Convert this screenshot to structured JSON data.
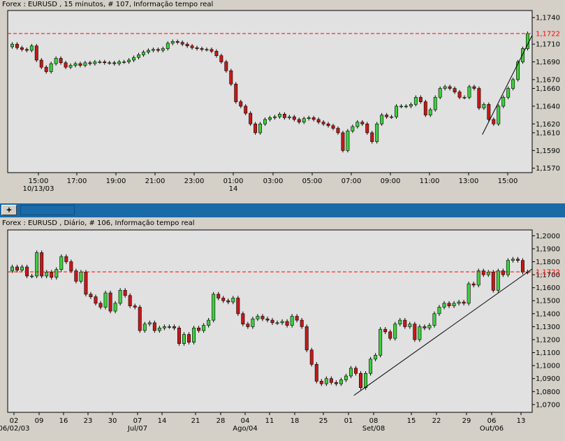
{
  "chart_data": [
    {
      "type": "candlestick",
      "title": "Forex : EURUSD , 15 minutos, # 107, Informação tempo real",
      "ylim": [
        1.1565,
        1.1748
      ],
      "y_ticks": [
        "1,1740",
        "1,1710",
        "1,1690",
        "1,1670",
        "1,1660",
        "1,1640",
        "1,1620",
        "1,1610",
        "1,1590",
        "1,1570"
      ],
      "y_tick_values": [
        1.174,
        1.171,
        1.169,
        1.167,
        1.166,
        1.164,
        1.162,
        1.161,
        1.159,
        1.157
      ],
      "x_ticks": [
        "15:00",
        "17:00",
        "19:00",
        "21:00",
        "23:00",
        "01:00",
        "03:00",
        "05:00",
        "07:00",
        "09:00",
        "11:00",
        "13:00",
        "15:00"
      ],
      "x_sub_labels": [
        "10/13/03",
        "",
        "",
        "",
        "",
        "14",
        "",
        "",
        "",
        "",
        "",
        "",
        ""
      ],
      "price_line": {
        "value": 1.1722,
        "label": "1,1722",
        "color": "#ff0000"
      },
      "trendline": {
        "from_bar": 0.905,
        "from_value": 1.1608,
        "to_bar": 1.0,
        "to_value": 1.172
      },
      "bar_count": 107,
      "closes": [
        1.171,
        1.1706,
        1.1704,
        1.1703,
        1.1708,
        1.1692,
        1.1684,
        1.1679,
        1.1688,
        1.1694,
        1.1689,
        1.1684,
        1.1686,
        1.1688,
        1.1686,
        1.1689,
        1.1688,
        1.169,
        1.169,
        1.1689,
        1.1689,
        1.1688,
        1.169,
        1.169,
        1.1692,
        1.1695,
        1.1698,
        1.1701,
        1.1703,
        1.1704,
        1.1703,
        1.1705,
        1.1711,
        1.1713,
        1.1712,
        1.171,
        1.1708,
        1.1706,
        1.1705,
        1.1704,
        1.1704,
        1.1702,
        1.1697,
        1.169,
        1.168,
        1.1665,
        1.1645,
        1.164,
        1.1632,
        1.162,
        1.161,
        1.162,
        1.1625,
        1.1627,
        1.1628,
        1.1631,
        1.1627,
        1.1628,
        1.1625,
        1.1622,
        1.1626,
        1.1627,
        1.1625,
        1.1622,
        1.162,
        1.1618,
        1.1615,
        1.161,
        1.159,
        1.1612,
        1.1617,
        1.1622,
        1.162,
        1.161,
        1.16,
        1.162,
        1.163,
        1.1628,
        1.1628,
        1.164,
        1.164,
        1.164,
        1.1642,
        1.165,
        1.1645,
        1.163,
        1.1636,
        1.165,
        1.166,
        1.1662,
        1.166,
        1.1656,
        1.165,
        1.165,
        1.1662,
        1.166,
        1.1638,
        1.1642,
        1.1625,
        1.162,
        1.164,
        1.165,
        1.166,
        1.167,
        1.169,
        1.1705,
        1.1722
      ]
    },
    {
      "type": "candlestick",
      "title": "Forex : EURUSD , Diário, # 106, Informação tempo real",
      "ylim": [
        1.064,
        1.2045
      ],
      "y_ticks": [
        "1,2000",
        "1,1900",
        "1,1800",
        "1,1700",
        "1,1600",
        "1,1500",
        "1,1400",
        "1,1300",
        "1,1200",
        "1,1100",
        "1,1000",
        "1,0900",
        "1,0800",
        "1,0700"
      ],
      "y_tick_values": [
        1.2,
        1.19,
        1.18,
        1.17,
        1.16,
        1.15,
        1.14,
        1.13,
        1.12,
        1.11,
        1.1,
        1.09,
        1.08,
        1.07
      ],
      "x_ticks": [
        "02",
        "09",
        "16",
        "23",
        "30",
        "07",
        "14",
        "21",
        "28",
        "04",
        "11",
        "18",
        "25",
        "01",
        "08",
        "15",
        "22",
        "29",
        "06",
        "13"
      ],
      "x_sub_labels": [
        "06/02/03",
        "",
        "",
        "",
        "",
        "Jul/07",
        "",
        "",
        "",
        "Ago/04",
        "",
        "",
        "",
        "",
        "Set/08",
        "",
        "",
        "",
        "Out/06",
        ""
      ],
      "price_line": {
        "value": 1.1722,
        "label": "1,1722",
        "color": "#ff0000"
      },
      "trendline": {
        "from_bar": 0.66,
        "from_value": 1.077,
        "to_bar": 1.0,
        "to_value": 1.1745
      },
      "bar_count": 106,
      "closes": [
        1.176,
        1.1735,
        1.176,
        1.169,
        1.169,
        1.187,
        1.169,
        1.172,
        1.168,
        1.174,
        1.184,
        1.18,
        1.173,
        1.165,
        1.172,
        1.155,
        1.153,
        1.148,
        1.145,
        1.156,
        1.142,
        1.148,
        1.158,
        1.154,
        1.146,
        1.145,
        1.127,
        1.132,
        1.133,
        1.127,
        1.129,
        1.13,
        1.13,
        1.129,
        1.117,
        1.124,
        1.118,
        1.129,
        1.127,
        1.131,
        1.135,
        1.155,
        1.152,
        1.15,
        1.149,
        1.152,
        1.14,
        1.132,
        1.13,
        1.136,
        1.138,
        1.136,
        1.135,
        1.133,
        1.133,
        1.134,
        1.131,
        1.138,
        1.135,
        1.13,
        1.112,
        1.101,
        1.088,
        1.086,
        1.09,
        1.087,
        1.086,
        1.089,
        1.092,
        1.098,
        1.094,
        1.083,
        1.094,
        1.105,
        1.108,
        1.128,
        1.126,
        1.121,
        1.132,
        1.135,
        1.13,
        1.132,
        1.12,
        1.13,
        1.129,
        1.131,
        1.14,
        1.145,
        1.148,
        1.146,
        1.148,
        1.149,
        1.148,
        1.163,
        1.162,
        1.173,
        1.17,
        1.172,
        1.158,
        1.173,
        1.17,
        1.181,
        1.182,
        1.181,
        1.172,
        1.1722
      ]
    }
  ]
}
